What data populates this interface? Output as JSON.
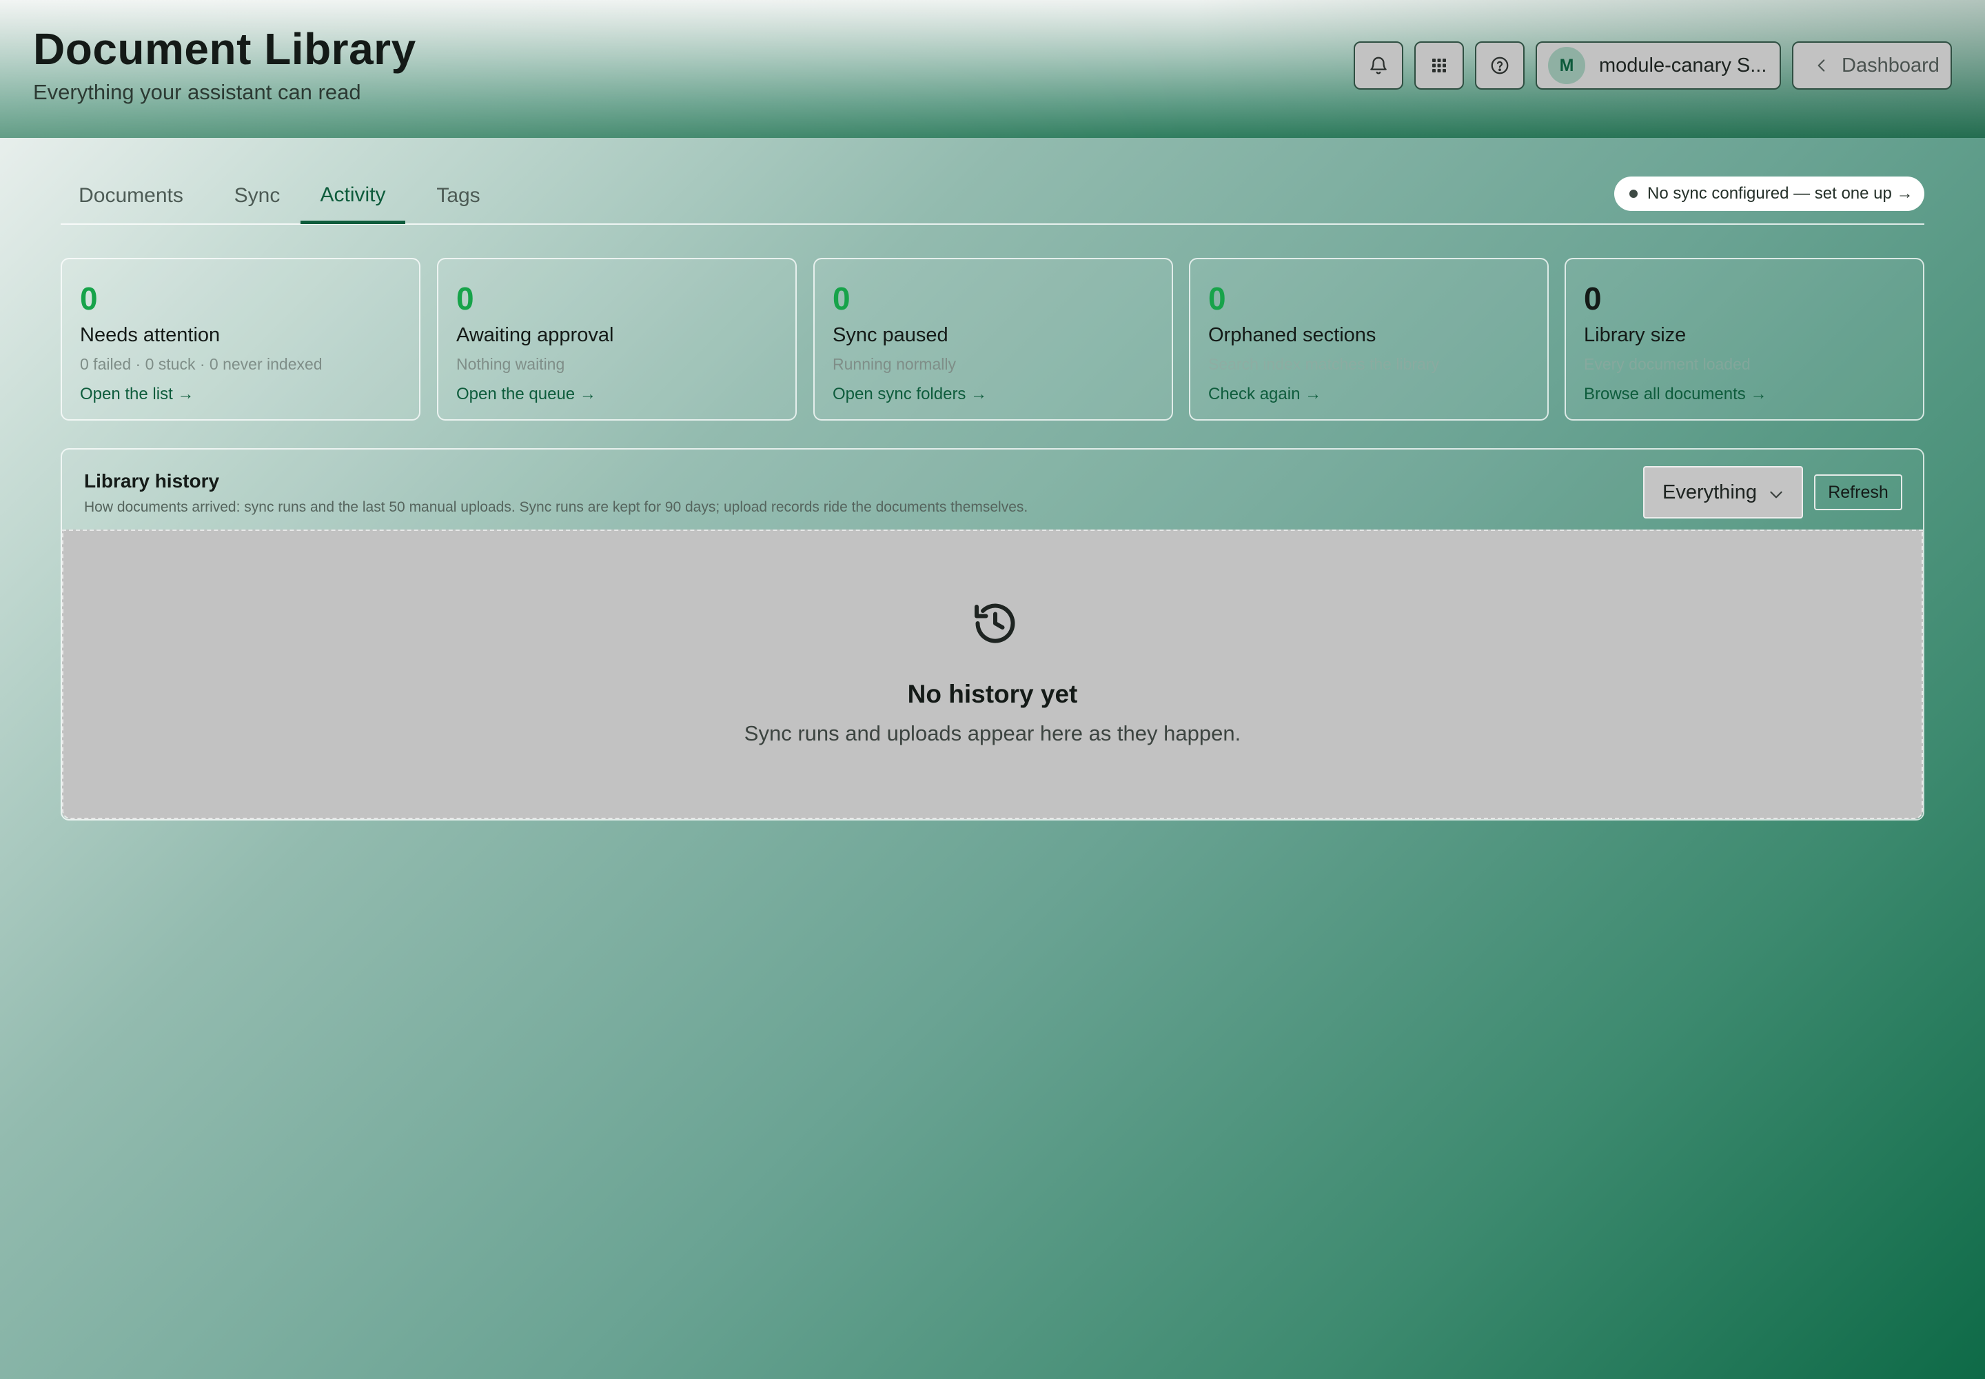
{
  "header": {
    "title": "Document Library",
    "subtitle": "Everything your assistant can read",
    "account": {
      "initial": "M",
      "name": "module-canary S..."
    },
    "dashboard_label": "Dashboard"
  },
  "tabs": [
    {
      "label": "Documents",
      "active": false
    },
    {
      "label": "Sync",
      "active": false
    },
    {
      "label": "Activity",
      "active": true
    },
    {
      "label": "Tags",
      "active": false
    }
  ],
  "sync_status": "No sync configured — set one up →",
  "stats": [
    {
      "value": "0",
      "label": "Needs attention",
      "detail": "0 failed · 0 stuck · 0 never indexed",
      "link": "Open the list →"
    },
    {
      "value": "0",
      "label": "Awaiting approval",
      "detail": "Nothing waiting",
      "link": "Open the queue →"
    },
    {
      "value": "0",
      "label": "Sync paused",
      "detail": "Running normally",
      "link": "Open sync folders →"
    },
    {
      "value": "0",
      "label": "Orphaned sections",
      "detail": "Search index matches the library",
      "link": "Check again →"
    },
    {
      "value": "0",
      "label": "Library size",
      "detail": "Every document loaded",
      "link": "Browse all documents →"
    }
  ],
  "history": {
    "title": "Library history",
    "description": "How documents arrived: sync runs and the last 50 manual uploads. Sync runs are kept for 90 days; upload records ride the documents themselves.",
    "filter_value": "Everything",
    "refresh_label": "Refresh",
    "empty_title": "No history yet",
    "empty_text": "Sync runs and uploads appear here as they happen."
  },
  "colors": {
    "accent": "#0e5c3c",
    "stat_green": "#17a34a"
  },
  "icons": [
    "bell-icon",
    "apps-grid-icon",
    "help-icon",
    "chevron-left-icon",
    "chevron-down-icon",
    "history-icon"
  ]
}
